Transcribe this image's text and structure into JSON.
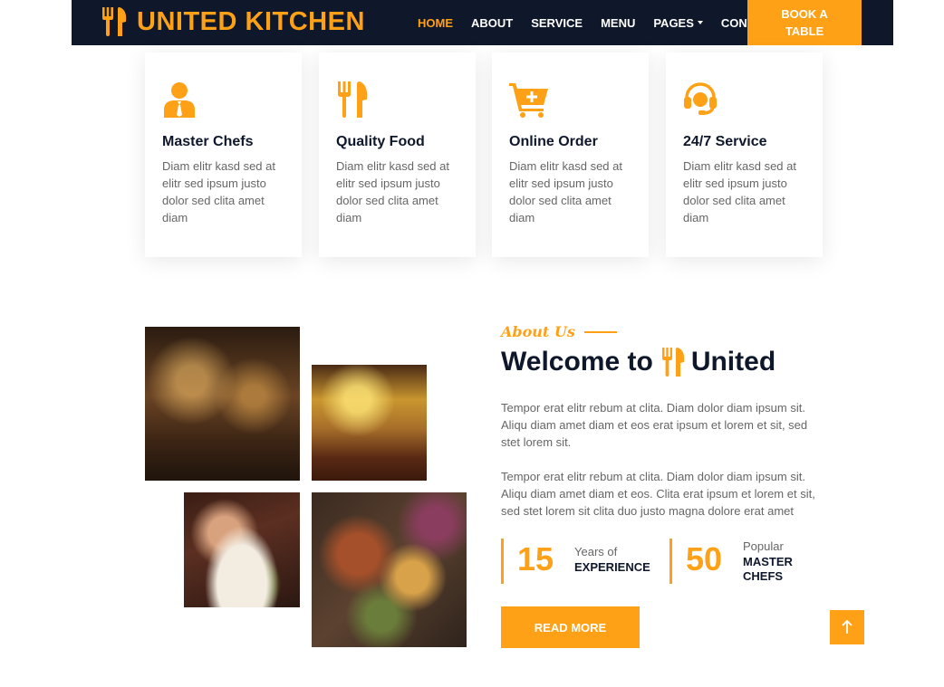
{
  "brand": {
    "name": "UNITED KITCHEN",
    "icon": "utensils-icon",
    "color": "#fea116"
  },
  "nav": {
    "items": [
      {
        "label": "HOME",
        "active": true
      },
      {
        "label": "ABOUT",
        "active": false
      },
      {
        "label": "SERVICE",
        "active": false
      },
      {
        "label": "MENU",
        "active": false
      },
      {
        "label": "PAGES",
        "active": false,
        "dropdown": true
      },
      {
        "label": "CONTACT",
        "active": false
      }
    ],
    "book_line1": "BOOK A",
    "book_line2": "TABLE"
  },
  "services": [
    {
      "icon": "user-tie-icon",
      "title": "Master Chefs",
      "text": "Diam elitr kasd sed at elitr sed ipsum justo dolor sed clita amet diam"
    },
    {
      "icon": "utensils-icon",
      "title": "Quality Food",
      "text": "Diam elitr kasd sed at elitr sed ipsum justo dolor sed clita amet diam"
    },
    {
      "icon": "cart-plus-icon",
      "title": "Online Order",
      "text": "Diam elitr kasd sed at elitr sed ipsum justo dolor sed clita amet diam"
    },
    {
      "icon": "headset-icon",
      "title": "24/7 Service",
      "text": "Diam elitr kasd sed at elitr sed ipsum justo dolor sed clita amet diam"
    }
  ],
  "about": {
    "label": "About Us",
    "title_before": "Welcome to",
    "title_after": "United",
    "para1": "Tempor erat elitr rebum at clita. Diam dolor diam ipsum sit. Aliqu diam amet diam et eos erat ipsum et lorem et sit, sed stet lorem sit.",
    "para2": "Tempor erat elitr rebum at clita. Diam dolor diam ipsum sit. Aliqu diam amet diam et eos. Clita erat ipsum et lorem et sit, sed stet lorem sit clita duo justo magna dolore erat amet",
    "stats": [
      {
        "number": "15",
        "label": "Years of",
        "strong": "EXPERIENCE"
      },
      {
        "number": "50",
        "label": "Popular",
        "strong_line1": "MASTER",
        "strong_line2": "CHEFS"
      }
    ],
    "read_more": "READ MORE"
  },
  "images": [
    {
      "name": "restaurant-interior-photo"
    },
    {
      "name": "restaurant-dining-photo"
    },
    {
      "name": "salad-plate-photo"
    },
    {
      "name": "grill-platter-photo"
    }
  ],
  "back_to_top": {
    "icon": "arrow-up-icon"
  },
  "colors": {
    "accent": "#fea116",
    "dark": "#0f172b",
    "text": "#666666"
  }
}
